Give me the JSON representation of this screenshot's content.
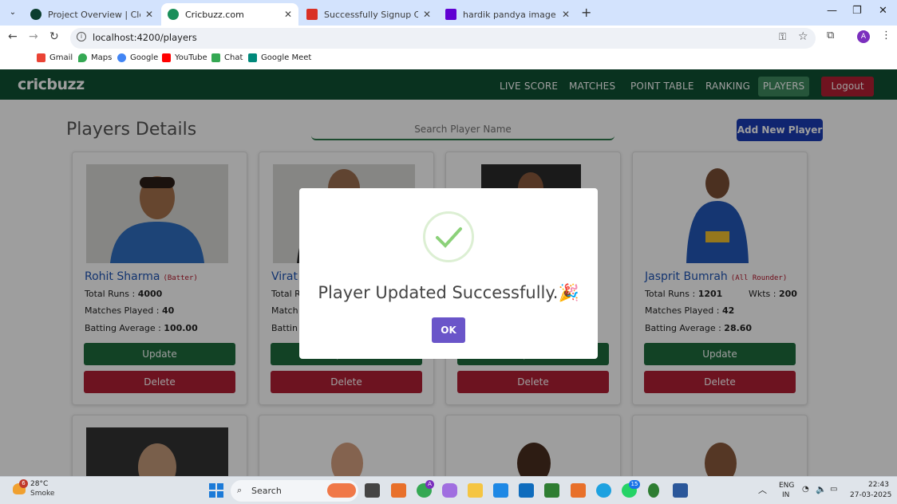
{
  "browser": {
    "tabs": [
      {
        "title": "Project Overview | Cloud: Mong",
        "color": "#0b3d2e"
      },
      {
        "title": "Cricbuzz.com",
        "color": "#1a8f5a"
      },
      {
        "title": "Successfully Signup Confirmati",
        "color": "#d93025"
      },
      {
        "title": "hardik pandya image - Yahoo I",
        "color": "#6001d2"
      }
    ],
    "url": "localhost:4200/players",
    "bookmarks": [
      "Gmail",
      "Maps",
      "Google",
      "YouTube",
      "Chat",
      "Google Meet"
    ],
    "profile_initial": "A"
  },
  "site": {
    "logo": "cricbuzz",
    "nav": [
      "LIVE SCORE",
      "MATCHES",
      "POINT TABLE",
      "RANKING",
      "PLAYERS"
    ],
    "logout": "Logout",
    "page_title": "Players Details",
    "search_placeholder": "Search Player Name",
    "add_button": "Add New Player",
    "update_label": "Update",
    "delete_label": "Delete",
    "players": [
      {
        "name": "Rohit Sharma",
        "role": "(Batter)",
        "runs_label": "Total Runs :",
        "runs": "4000",
        "matches_label": "Matches Played :",
        "matches": "40",
        "avg_label": "Batting Average :",
        "avg": "100.00"
      },
      {
        "name": "Virat",
        "runs_label": "Total R",
        "matches_label": "Match",
        "avg_label": "Battin"
      },
      {},
      {
        "name": "Jasprit Bumrah",
        "role": "(All Rounder)",
        "runs_label": "Total Runs :",
        "runs": "1201",
        "wkts_label": "Wkts :",
        "wkts": "200",
        "matches_label": "Matches Played :",
        "matches": "42",
        "avg_label": "Batting Average :",
        "avg": "28.60"
      }
    ]
  },
  "modal": {
    "message": "Player Updated Successfully.🎉",
    "ok": "OK"
  },
  "taskbar": {
    "temp": "28°C",
    "weather": "Smoke",
    "weather_badge": "6",
    "search": "Search",
    "lang1": "ENG",
    "lang2": "IN",
    "time": "22:43",
    "date": "27-03-2025",
    "chrome_badge": "A",
    "whatsapp_badge": "15"
  }
}
